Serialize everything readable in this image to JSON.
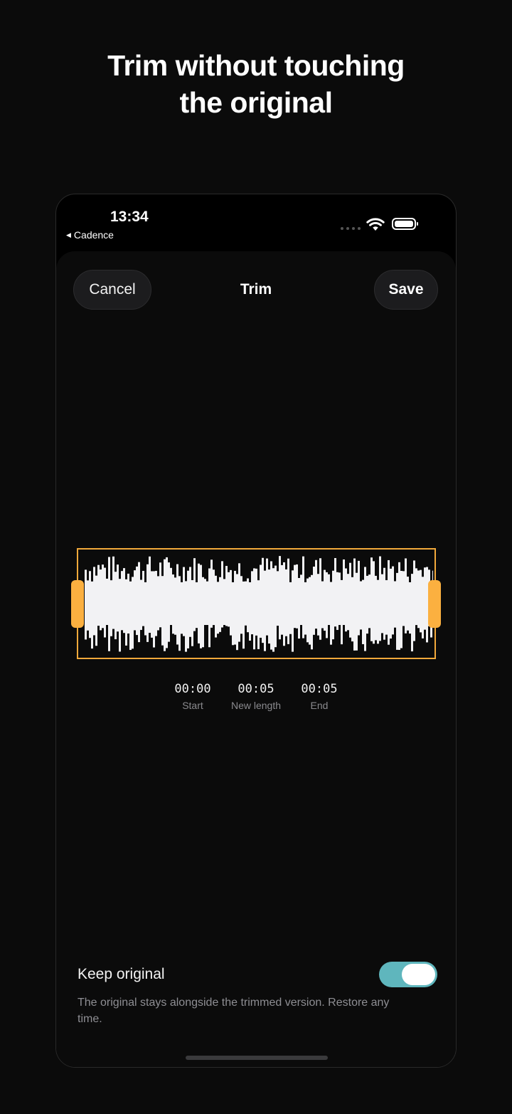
{
  "headline": {
    "line1": "Trim without touching",
    "line2": "the original"
  },
  "status_bar": {
    "time": "13:34",
    "back_app": "Cadence",
    "icons": [
      "signal-dots-icon",
      "wifi-icon",
      "battery-icon"
    ]
  },
  "nav": {
    "cancel_label": "Cancel",
    "title": "Trim",
    "save_label": "Save"
  },
  "trim": {
    "start": "00:00",
    "start_label": "Start",
    "length": "00:05",
    "length_label": "New length",
    "end": "00:05",
    "end_label": "End",
    "accent_color": "#f2a93b"
  },
  "keep_original": {
    "label": "Keep original",
    "enabled": true,
    "description": "The original stays alongside the trimmed version. Restore any time.",
    "toggle_color": "#5fb6bd"
  }
}
